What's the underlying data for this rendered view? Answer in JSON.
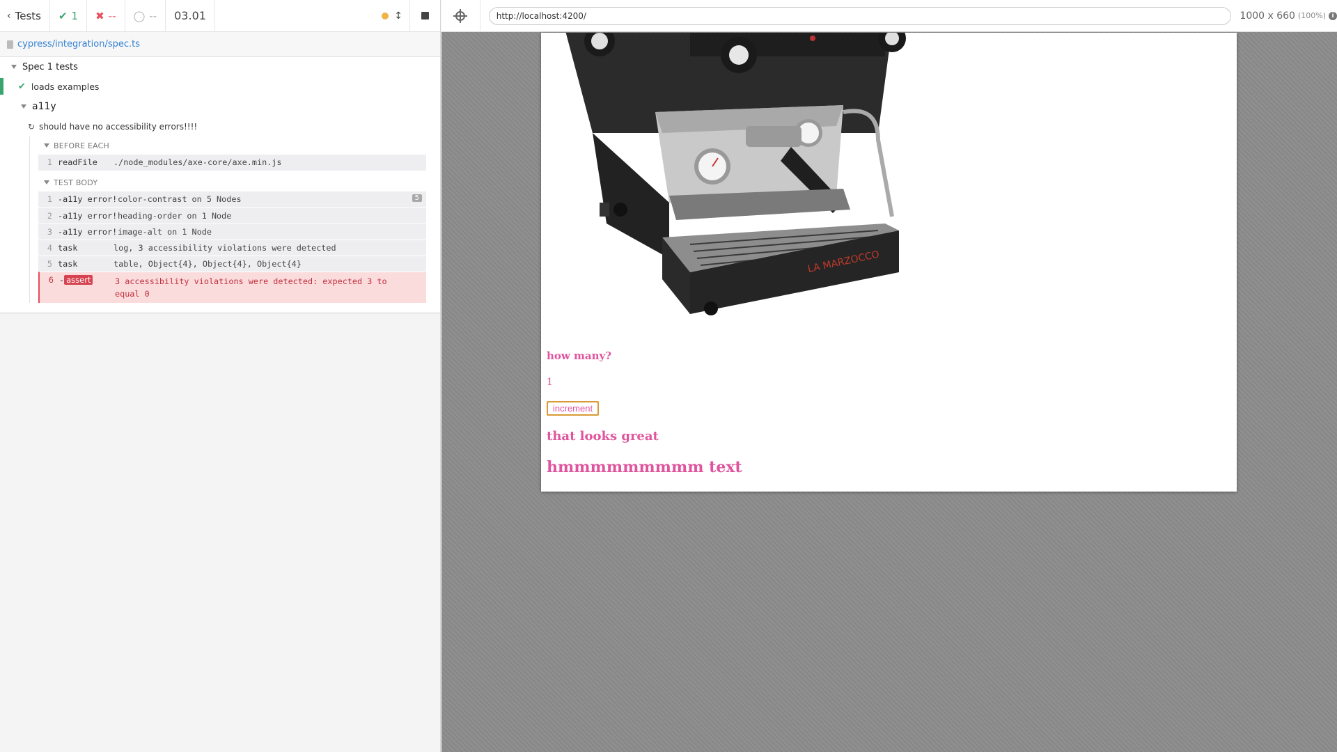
{
  "reporter": {
    "header": {
      "back_label": "Tests",
      "passed": "1",
      "failed": "--",
      "pending": "--",
      "duration": "03.01"
    },
    "spec_path": "cypress/integration/spec.ts",
    "root_suite": "Spec 1 tests",
    "test_passed": "loads examples",
    "suite": "a11y",
    "test_running": "should have no accessibility errors!!!!",
    "before_each": {
      "title": "BEFORE EACH",
      "commands": [
        {
          "num": "1",
          "name": "readFile",
          "msg": "./node_modules/axe-core/axe.min.js"
        }
      ]
    },
    "test_body": {
      "title": "TEST BODY",
      "commands": [
        {
          "num": "1",
          "name": "-a11y error!",
          "msg": "color-contrast on 5 Nodes",
          "badge": "5"
        },
        {
          "num": "2",
          "name": "-a11y error!",
          "msg": "heading-order on 1 Node"
        },
        {
          "num": "3",
          "name": "-a11y error!",
          "msg": "image-alt on 1 Node"
        },
        {
          "num": "4",
          "name": "task",
          "msg": "log, 3 accessibility violations were detected"
        },
        {
          "num": "5",
          "name": "task",
          "msg": "table, Object{4}, Object{4}, Object{4}"
        },
        {
          "num": "6",
          "name": "assert",
          "prefix": "-",
          "msg": "3 accessibility violations were detected: expected 3 to equal 0"
        }
      ]
    }
  },
  "aut": {
    "url": "http://localhost:4200/",
    "viewport": "1000 x 660",
    "zoom": "(100%)",
    "app": {
      "question": "how many?",
      "count": "1",
      "button_label": "increment",
      "great_text": "that looks great",
      "hmm_text": "hmmmmmmmmm text",
      "accent_color": "#e0549e",
      "machine_logo_text": "LA MARZOCCO"
    }
  },
  "colors": {
    "pass": "#3aa46f",
    "fail": "#e94f5f",
    "running": "#f0b445",
    "link": "#3380d4"
  }
}
